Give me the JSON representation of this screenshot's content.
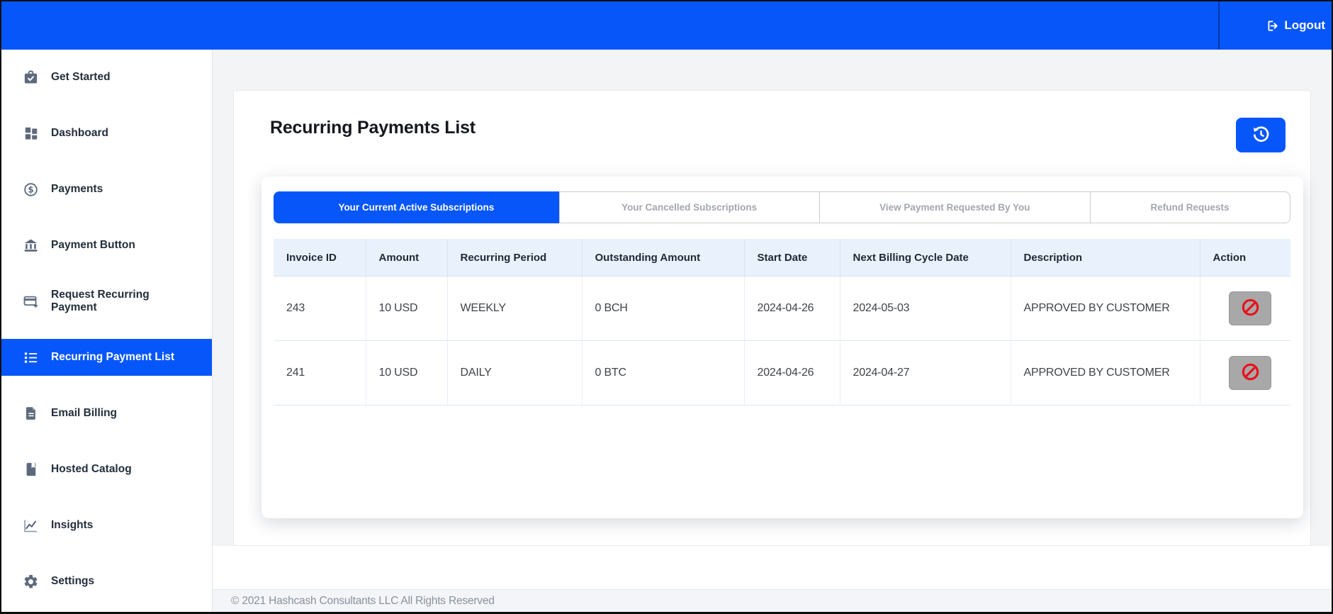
{
  "topbar": {
    "logout_label": "Logout",
    "logout_icon": "logout-icon"
  },
  "sidebar": {
    "items": [
      {
        "label": "Get Started",
        "icon": "briefcase-check-icon",
        "active": false
      },
      {
        "label": "Dashboard",
        "icon": "dashboard-grid-icon",
        "active": false
      },
      {
        "label": "Payments",
        "icon": "dollar-circle-icon",
        "active": false
      },
      {
        "label": "Payment Button",
        "icon": "bank-icon",
        "active": false
      },
      {
        "label": "Request Recurring Payment",
        "icon": "card-plus-icon",
        "active": false
      },
      {
        "label": "Recurring Payment List",
        "icon": "list-icon",
        "active": true
      },
      {
        "label": "Email Billing",
        "icon": "document-icon",
        "active": false
      },
      {
        "label": "Hosted Catalog",
        "icon": "book-icon",
        "active": false
      },
      {
        "label": "Insights",
        "icon": "chart-line-icon",
        "active": false
      },
      {
        "label": "Settings",
        "icon": "gear-icon",
        "active": false
      }
    ]
  },
  "main": {
    "title": "Recurring Payments List",
    "refresh_button": {
      "icon": "history-icon"
    },
    "tabs": [
      {
        "label": "Your Current Active Subscriptions",
        "active": true
      },
      {
        "label": "Your Cancelled Subscriptions",
        "active": false
      },
      {
        "label": "View Payment Requested By You",
        "active": false
      },
      {
        "label": "Refund Requests",
        "active": false
      }
    ],
    "table": {
      "columns": [
        "Invoice ID",
        "Amount",
        "Recurring Period",
        "Outstanding Amount",
        "Start Date",
        "Next Billing Cycle Date",
        "Description",
        "Action"
      ],
      "rows": [
        {
          "invoice_id": "243",
          "amount": "10 USD",
          "recurring_period": "WEEKLY",
          "outstanding_amount": "0 BCH",
          "start_date": "2024-04-26",
          "next_billing_cycle_date": "2024-05-03",
          "description": "APPROVED BY CUSTOMER",
          "action_icon": "block-icon"
        },
        {
          "invoice_id": "241",
          "amount": "10 USD",
          "recurring_period": "DAILY",
          "outstanding_amount": "0 BTC",
          "start_date": "2024-04-26",
          "next_billing_cycle_date": "2024-04-27",
          "description": "APPROVED BY CUSTOMER",
          "action_icon": "block-icon"
        }
      ]
    }
  },
  "footer": {
    "copyright": "© 2021 Hashcash Consultants LLC All Rights Reserved"
  },
  "colors": {
    "accent_blue": "#0656fa",
    "danger_red": "#e8101c",
    "table_header_bg": "#e9f1fc",
    "action_button_bg": "#a8a8a8",
    "sidebar_icon": "#5d6a7d",
    "inactive_tab_text": "#a3a7ac",
    "content_bg": "#f3f4f6"
  }
}
